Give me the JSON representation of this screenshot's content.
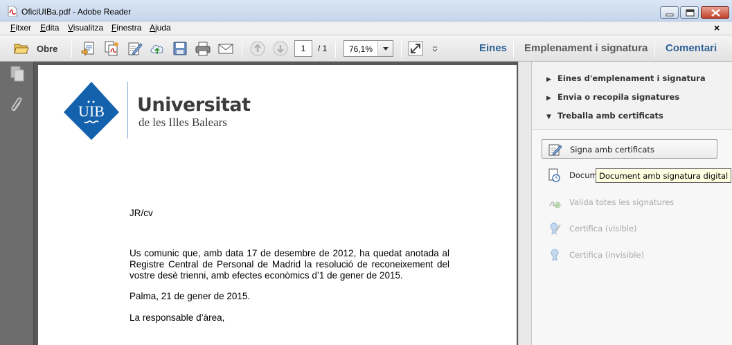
{
  "window": {
    "title": "OficiUIBa.pdf - Adobe Reader"
  },
  "menu": {
    "items": [
      "Fitxer",
      "Edita",
      "Visualitza",
      "Finestra",
      "Ajuda"
    ],
    "close_doc": "×"
  },
  "toolbar": {
    "open_label": "Obre",
    "page_current": "1",
    "page_total": "/ 1",
    "zoom": "76,1%",
    "tabs": [
      "Eines",
      "Emplenament i signatura",
      "Comentari"
    ]
  },
  "document": {
    "university_name": "Universitat",
    "university_sub": "de les Illes Balears",
    "logo_text": "UIB",
    "reference": "JR/cv",
    "paragraph": "Us comunic que, amb data 17 de desembre de 2012, ha quedat anotada al Registre Central de Personal de Madrid la resolució de reconeixement del vostre desè trienni, amb efectes econòmics d’1 de gener de 2015.",
    "place_date": "Palma, 21 de gener de 2015.",
    "signature": "La responsable d’àrea,"
  },
  "right_panel": {
    "sections": [
      {
        "label": "Eines d'emplenament i signatura",
        "expanded": false
      },
      {
        "label": "Envia o recopila signatures",
        "expanded": false
      },
      {
        "label": "Treballa amb certificats",
        "expanded": true
      }
    ],
    "actions": [
      {
        "label": "Signa amb certificats",
        "enabled": true,
        "icon": "sign-certificate-icon"
      },
      {
        "label": "Docum",
        "enabled": true,
        "icon": "timestamp-document-icon"
      },
      {
        "label": "Valida totes les signatures",
        "enabled": false,
        "icon": "validate-signatures-icon"
      },
      {
        "label": "Certifica (visible)",
        "enabled": false,
        "icon": "certify-visible-icon"
      },
      {
        "label": "Certifica (invisible)",
        "enabled": false,
        "icon": "certify-invisible-icon"
      }
    ],
    "tooltip": "Document amb signatura digital"
  },
  "colors": {
    "uib_blue": "#1462ad",
    "tab_blue": "#2f6296",
    "nav_gray": "#6d6d6d"
  }
}
